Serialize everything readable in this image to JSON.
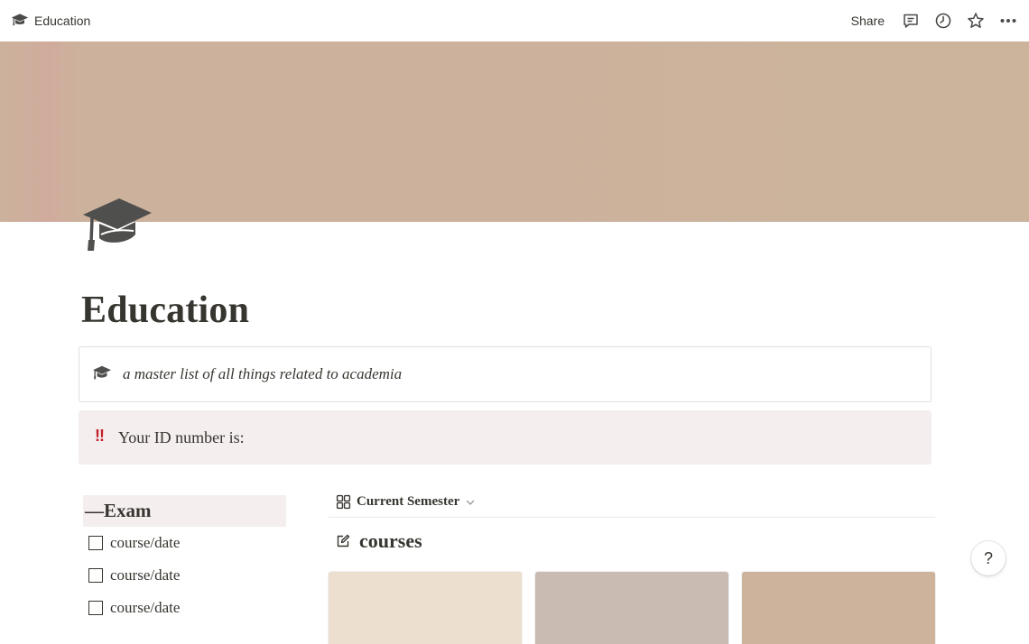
{
  "topbar": {
    "breadcrumb": "Education",
    "breadcrumb_icon": "graduation-cap-icon",
    "share_label": "Share",
    "icons": [
      "comment-icon",
      "clock-icon",
      "star-icon",
      "more-icon"
    ]
  },
  "cover": {
    "color": "#ccb39c"
  },
  "page": {
    "icon": "graduation-cap-icon",
    "title": "Education"
  },
  "callouts": {
    "description": "a master list of all things related to academia",
    "id_marker": "!!",
    "id_text": "Your ID number is:"
  },
  "exam": {
    "heading": "—Exam",
    "todos": [
      {
        "label": "course/date",
        "checked": false
      },
      {
        "label": "course/date",
        "checked": false
      },
      {
        "label": "course/date",
        "checked": false
      }
    ]
  },
  "database": {
    "view_label": "Current Semester",
    "title": "courses",
    "card_colors": [
      "#ecdfd0",
      "#c9bab2",
      "#cdb39c"
    ]
  },
  "help": {
    "label": "?"
  },
  "colors": {
    "text": "#37352f",
    "callout_bg": "#f4eeee",
    "warning": "#c4202a"
  }
}
